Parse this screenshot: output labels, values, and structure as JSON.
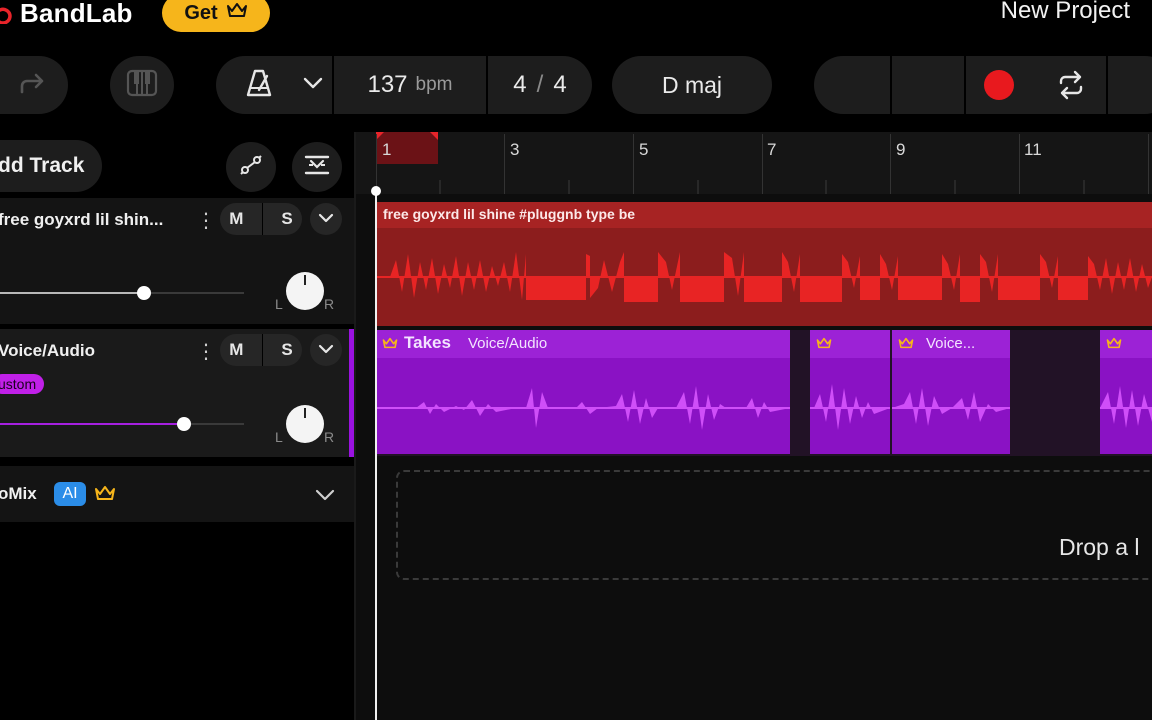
{
  "app": {
    "brand": "BandLab",
    "get_label": "Get",
    "project_title": "New Project"
  },
  "toolbar": {
    "bpm_value": "137",
    "bpm_unit": "bpm",
    "time_sig_top": "4",
    "time_sig_slash": "/",
    "time_sig_bottom": "4",
    "key": "D maj"
  },
  "tracks_panel": {
    "add_track_label": "dd Track",
    "tracks": [
      {
        "name": "free goyxrd  lil shin...",
        "mute": "M",
        "solo": "S",
        "pan_l": "L",
        "pan_r": "R",
        "volume_fraction": 0.59
      },
      {
        "name": "Voice/Audio",
        "mute": "M",
        "solo": "S",
        "badge": "ustom",
        "pan_l": "L",
        "pan_r": "R",
        "volume_fraction": 0.75
      }
    ],
    "automix_label": "oMix",
    "ai_badge": "AI"
  },
  "timeline": {
    "bar_numbers": [
      "1",
      "3",
      "5",
      "7",
      "9",
      "11"
    ],
    "red_clip_title": "free goyxrd  lil shine  #pluggnb type be",
    "purple_clips": [
      {
        "bold": "Takes",
        "label": "Voice/Audio"
      },
      {
        "bold": "",
        "label": ""
      },
      {
        "bold": "",
        "label": "Voice..."
      },
      {
        "bold": "",
        "label": ""
      }
    ],
    "drop_text": "Drop a l"
  },
  "colors": {
    "accent_yellow": "#f6b51b",
    "record_red": "#e8191e",
    "track_red": "#a72323",
    "track_purple": "#9c22d6",
    "ai_blue": "#2b8de8"
  },
  "icons": [
    "logo-icon",
    "crown-icon",
    "redo-icon",
    "piano-icon",
    "metronome-icon",
    "chevron-down-icon",
    "record-icon",
    "loop-icon",
    "automation-icon",
    "fx-icon",
    "more-icon"
  ]
}
